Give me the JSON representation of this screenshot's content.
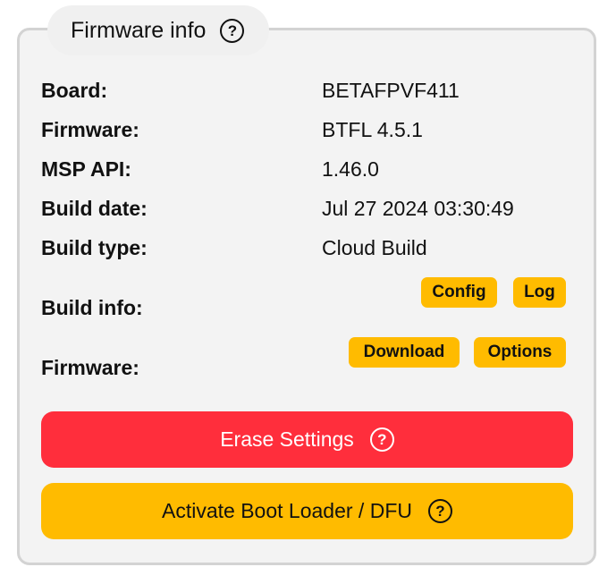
{
  "panel": {
    "title": "Firmware info",
    "help_icon": "question-circle-icon"
  },
  "info": {
    "board": {
      "label": "Board:",
      "value": "BETAFPVF411"
    },
    "firmware": {
      "label": "Firmware:",
      "value": "BTFL 4.5.1"
    },
    "msp_api": {
      "label": "MSP API:",
      "value": "1.46.0"
    },
    "build_date": {
      "label": "Build date:",
      "value": "Jul 27 2024 03:30:49"
    },
    "build_type": {
      "label": "Build type:",
      "value": "Cloud Build"
    },
    "build_info": {
      "label": "Build info:",
      "config": "Config",
      "log": "Log"
    },
    "firmware_dl": {
      "label": "Firmware:",
      "download": "Download",
      "options": "Options"
    }
  },
  "buttons": {
    "erase": "Erase Settings",
    "dfu": "Activate Boot Loader / DFU"
  },
  "colors": {
    "accent_yellow": "#ffbb00",
    "danger_red": "#ff2e3c",
    "panel_bg": "#f3f3f3",
    "border": "#d3d3d3"
  }
}
